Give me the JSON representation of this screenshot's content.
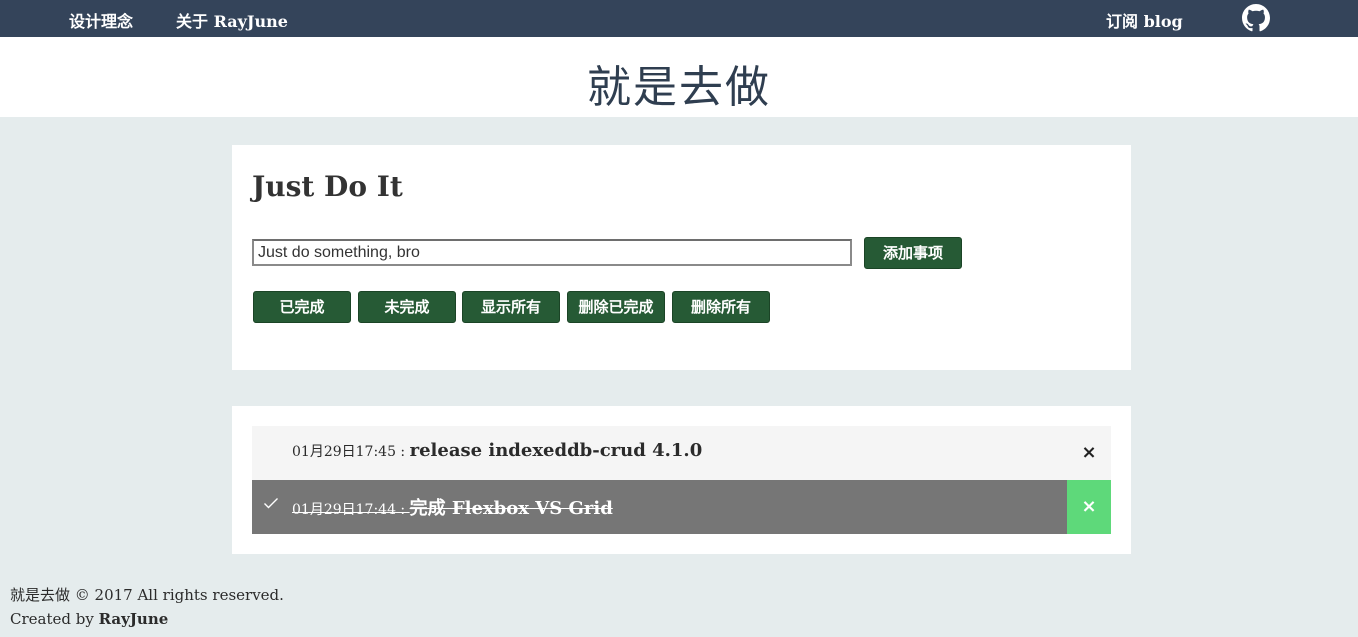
{
  "nav": {
    "links": [
      "设计理念",
      "关于 RayJune"
    ],
    "subscribe": "订阅 blog",
    "github_icon": "github-icon"
  },
  "header": {
    "site_title": "就是去做"
  },
  "form": {
    "title": "Just Do It",
    "input_value": "Just do something, bro",
    "add_button": "添加事项",
    "filter_buttons": [
      "已完成",
      "未完成",
      "显示所有",
      "删除已完成",
      "删除所有"
    ]
  },
  "todos": [
    {
      "time": "01月29日17:45",
      "sep": " : ",
      "content": "release indexeddb-crud 4.1.0",
      "done": false,
      "delete_label": "×"
    },
    {
      "time": "01月29日17:44",
      "sep": " : ",
      "content": "完成 Flexbox VS Grid",
      "done": true,
      "delete_label": "×",
      "check_icon": "checkmark-icon"
    }
  ],
  "footer": {
    "copyright": "就是去做 © 2017 All rights reserved.",
    "created_by": "Created by ",
    "author": "RayJune"
  },
  "colors": {
    "nav_bg": "#34445a",
    "button_green": "#265a35",
    "done_row_bg": "#767676",
    "done_delete_bg": "#5ed97a",
    "page_bg": "#e5eced"
  }
}
